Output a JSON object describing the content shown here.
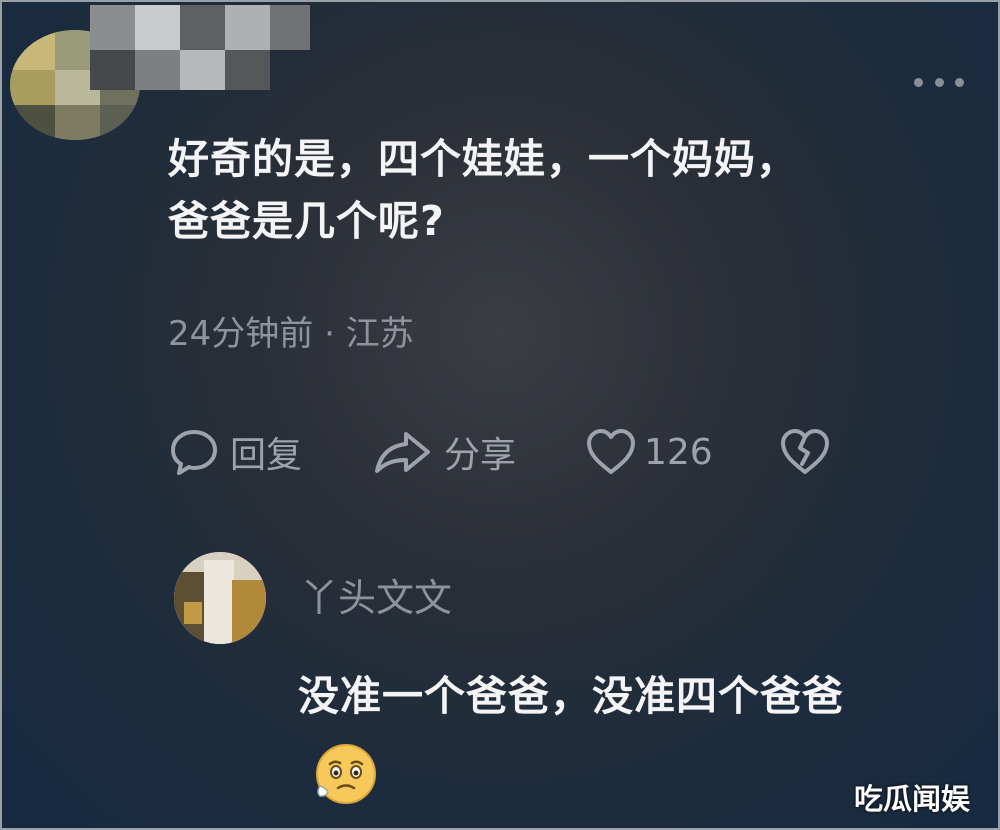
{
  "comment": {
    "line1": "好奇的是，四个娃娃，一个妈妈，",
    "line2": "爸爸是几个呢?",
    "time": "24分钟前",
    "separator": " · ",
    "location": "江苏",
    "more_icon": "more-dots-icon"
  },
  "actions": {
    "reply_label": "回复",
    "reply_icon": "comment-bubble-icon",
    "share_label": "分享",
    "share_icon": "share-arrow-icon",
    "like_count": "126",
    "like_icon": "heart-outline-icon",
    "dislike_icon": "broken-heart-icon"
  },
  "reply": {
    "username": "丫头文文",
    "text": "没准一个爸爸，没准四个爸爸",
    "emoji_icon": "worried-face-icon"
  },
  "watermark": "吃瓜闻娱",
  "colors": {
    "primary_text": "#f4f4f6",
    "secondary_text": "#8f949c",
    "bg_top": "#2a2e36",
    "bg_bottom": "#172a42"
  }
}
